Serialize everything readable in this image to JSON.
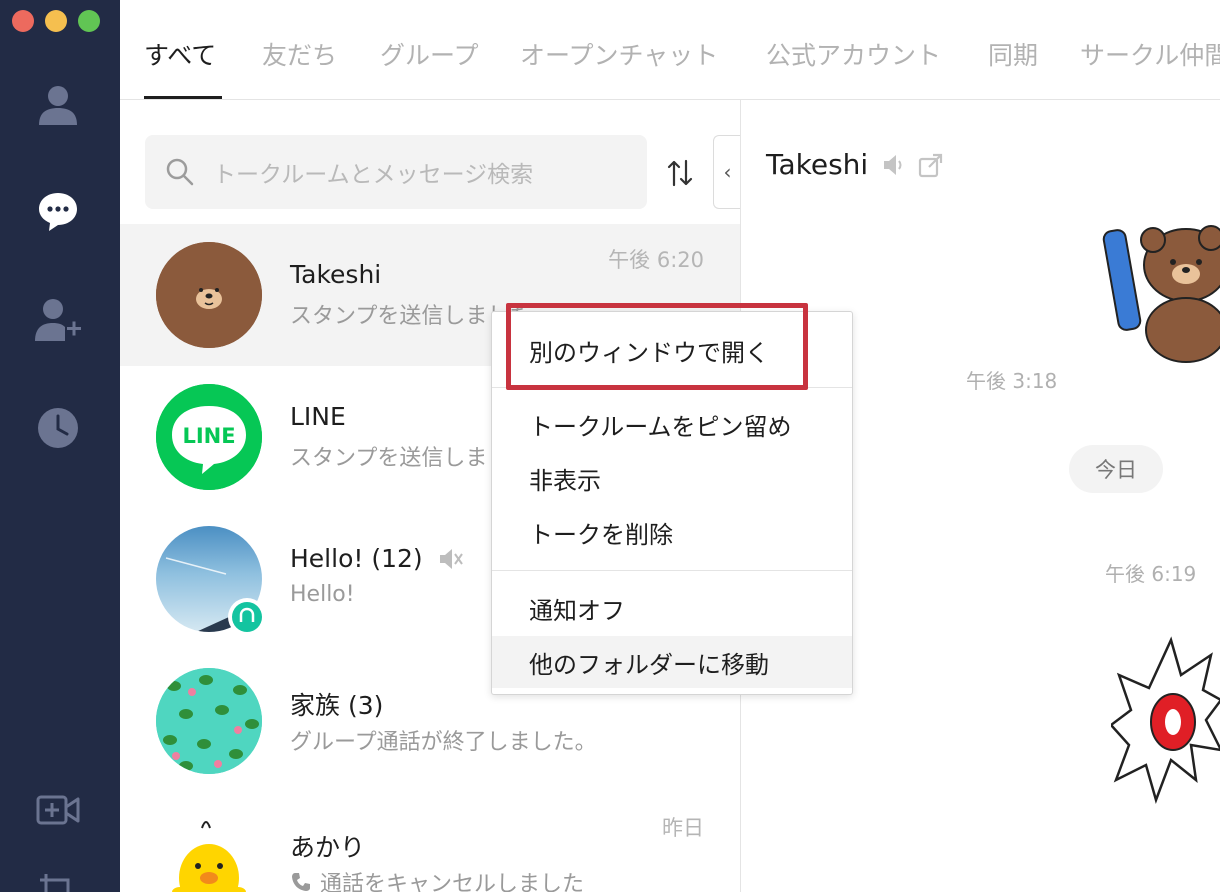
{
  "tabs": [
    {
      "label": "すべて"
    },
    {
      "label": "友だち"
    },
    {
      "label": "グループ"
    },
    {
      "label": "オープンチャット"
    },
    {
      "label": "公式アカウント"
    },
    {
      "label": "同期"
    },
    {
      "label": "サークル仲間"
    }
  ],
  "search": {
    "placeholder": "トークルームとメッセージ検索"
  },
  "chats": [
    {
      "name": "Takeshi",
      "message": "スタンプを送信しました",
      "time": "午後 6:20"
    },
    {
      "name": "LINE",
      "message": "スタンプを送信しました",
      "time": ""
    },
    {
      "name": "Hello! (12)",
      "message": "Hello!",
      "time": ""
    },
    {
      "name": "家族 (3)",
      "message": "グループ通話が終了しました。",
      "time": ""
    },
    {
      "name": "あかり",
      "message": "通話をキャンセルしました",
      "time": "昨日"
    }
  ],
  "pane": {
    "title": "Takeshi",
    "time1": "午後 3:18",
    "date_pill": "今日",
    "time2": "午後 6:19"
  },
  "logo_text": "LINE",
  "context_menu": {
    "items": [
      "別のウィンドウで開く",
      "トークルームをピン留め",
      "非表示",
      "トークを削除",
      "通知オフ",
      "他のフォルダーに移動"
    ]
  },
  "colors": {
    "sidebar": "#222b45",
    "highlight": "#c8333f",
    "line_green": "#06c755"
  }
}
